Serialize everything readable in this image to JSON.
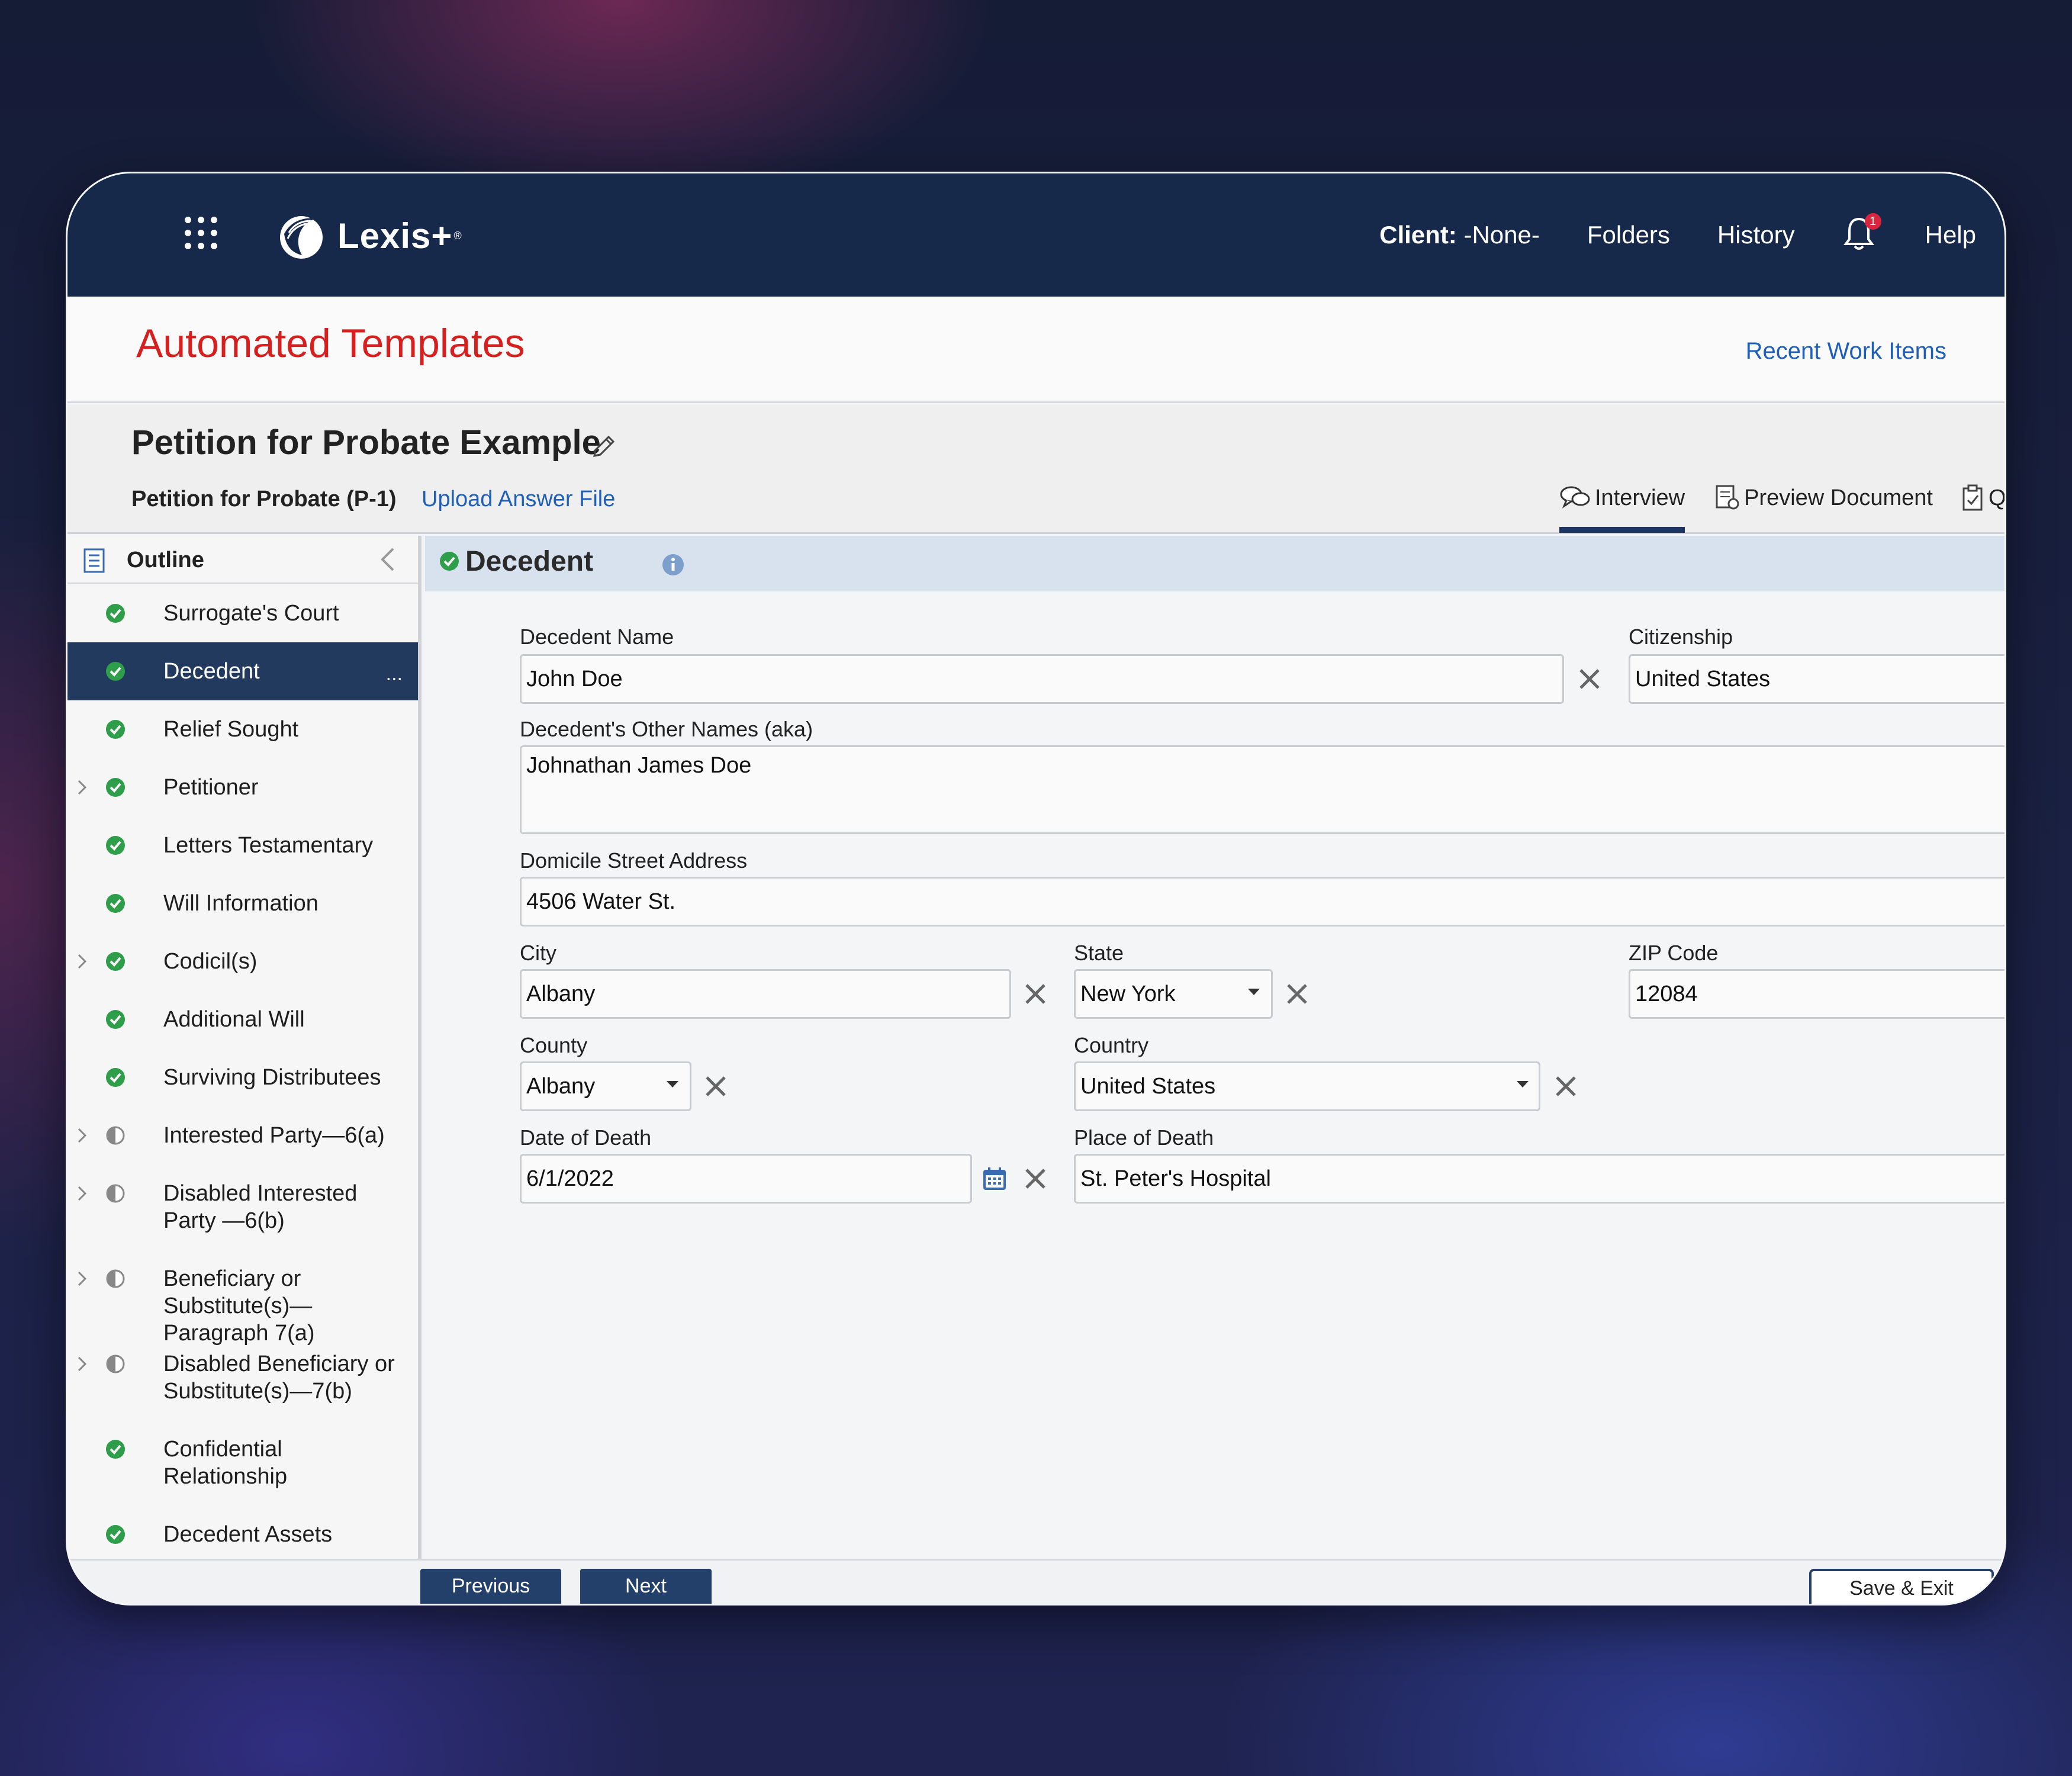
{
  "nav": {
    "brand": "Lexis+",
    "brand_mark": "®",
    "client_label": "Client:",
    "client_value": " -None-",
    "folders": "Folders",
    "history": "History",
    "notifications_count": "1",
    "help": "Help"
  },
  "header": {
    "title": "Automated Templates",
    "recent_link": "Recent Work Items"
  },
  "doc": {
    "title": "Petition for Probate Example",
    "subtitle": "Petition for Probate (P-1)",
    "upload_link": "Upload Answer File",
    "tabs": [
      {
        "label": "Interview",
        "icon": "chat-bubbles-icon",
        "active": true
      },
      {
        "label": "Preview Document",
        "icon": "document-preview-icon",
        "active": false
      },
      {
        "label": "Q&",
        "icon": "clipboard-check-icon",
        "active": false
      }
    ]
  },
  "outline": {
    "title": "Outline",
    "items": [
      {
        "label": "Surrogate's Court",
        "status": "complete",
        "expandable": false
      },
      {
        "label": "Decedent",
        "status": "complete",
        "expandable": false,
        "active": true
      },
      {
        "label": "Relief Sought",
        "status": "complete",
        "expandable": false
      },
      {
        "label": "Petitioner",
        "status": "complete",
        "expandable": true
      },
      {
        "label": "Letters Testamentary",
        "status": "complete",
        "expandable": false
      },
      {
        "label": "Will Information",
        "status": "complete",
        "expandable": false
      },
      {
        "label": "Codicil(s)",
        "status": "complete",
        "expandable": true
      },
      {
        "label": "Additional Will",
        "status": "complete",
        "expandable": false
      },
      {
        "label": "Surviving Distributees",
        "status": "complete",
        "expandable": false
      },
      {
        "label": "Interested Party—6(a)",
        "status": "partial",
        "expandable": true
      },
      {
        "label": "Disabled Interested Party —6(b)",
        "status": "partial",
        "expandable": true
      },
      {
        "label": "Beneficiary or Substitute(s)—Paragraph 7(a)",
        "status": "partial",
        "expandable": true
      },
      {
        "label": "Disabled Beneficiary or Substitute(s)—7(b)",
        "status": "partial",
        "expandable": true
      },
      {
        "label": "Confidential Relationship",
        "status": "complete",
        "expandable": false
      },
      {
        "label": "Decedent Assets",
        "status": "complete",
        "expandable": false
      }
    ],
    "more_label": "..."
  },
  "section": {
    "title": "Decedent",
    "fields": {
      "decedent_name": {
        "label": "Decedent Name",
        "value": "John Doe"
      },
      "citizenship": {
        "label": "Citizenship",
        "value": "United States"
      },
      "other_names": {
        "label": "Decedent's Other Names (aka)",
        "value": "Johnathan James Doe"
      },
      "street": {
        "label": "Domicile Street Address",
        "value": "4506 Water St."
      },
      "city": {
        "label": "City",
        "value": "Albany"
      },
      "state": {
        "label": "State",
        "value": "New York"
      },
      "zip": {
        "label": "ZIP Code",
        "value": "12084"
      },
      "county": {
        "label": "County",
        "value": "Albany"
      },
      "country": {
        "label": "Country",
        "value": "United States"
      },
      "date_of_death": {
        "label": "Date of Death",
        "value": "6/1/2022"
      },
      "place_of_death": {
        "label": "Place of Death",
        "value": "St. Peter's Hospital"
      }
    }
  },
  "footer": {
    "previous": "Previous",
    "next": "Next",
    "save_exit": "Save & Exit"
  },
  "colors": {
    "nav_bg": "#16294a",
    "title_red": "#d61f1f",
    "link_blue": "#1f5fb8",
    "complete_green": "#2e9e4a",
    "active_item_bg": "#223a5e",
    "section_bar": "#d8e2ee"
  }
}
